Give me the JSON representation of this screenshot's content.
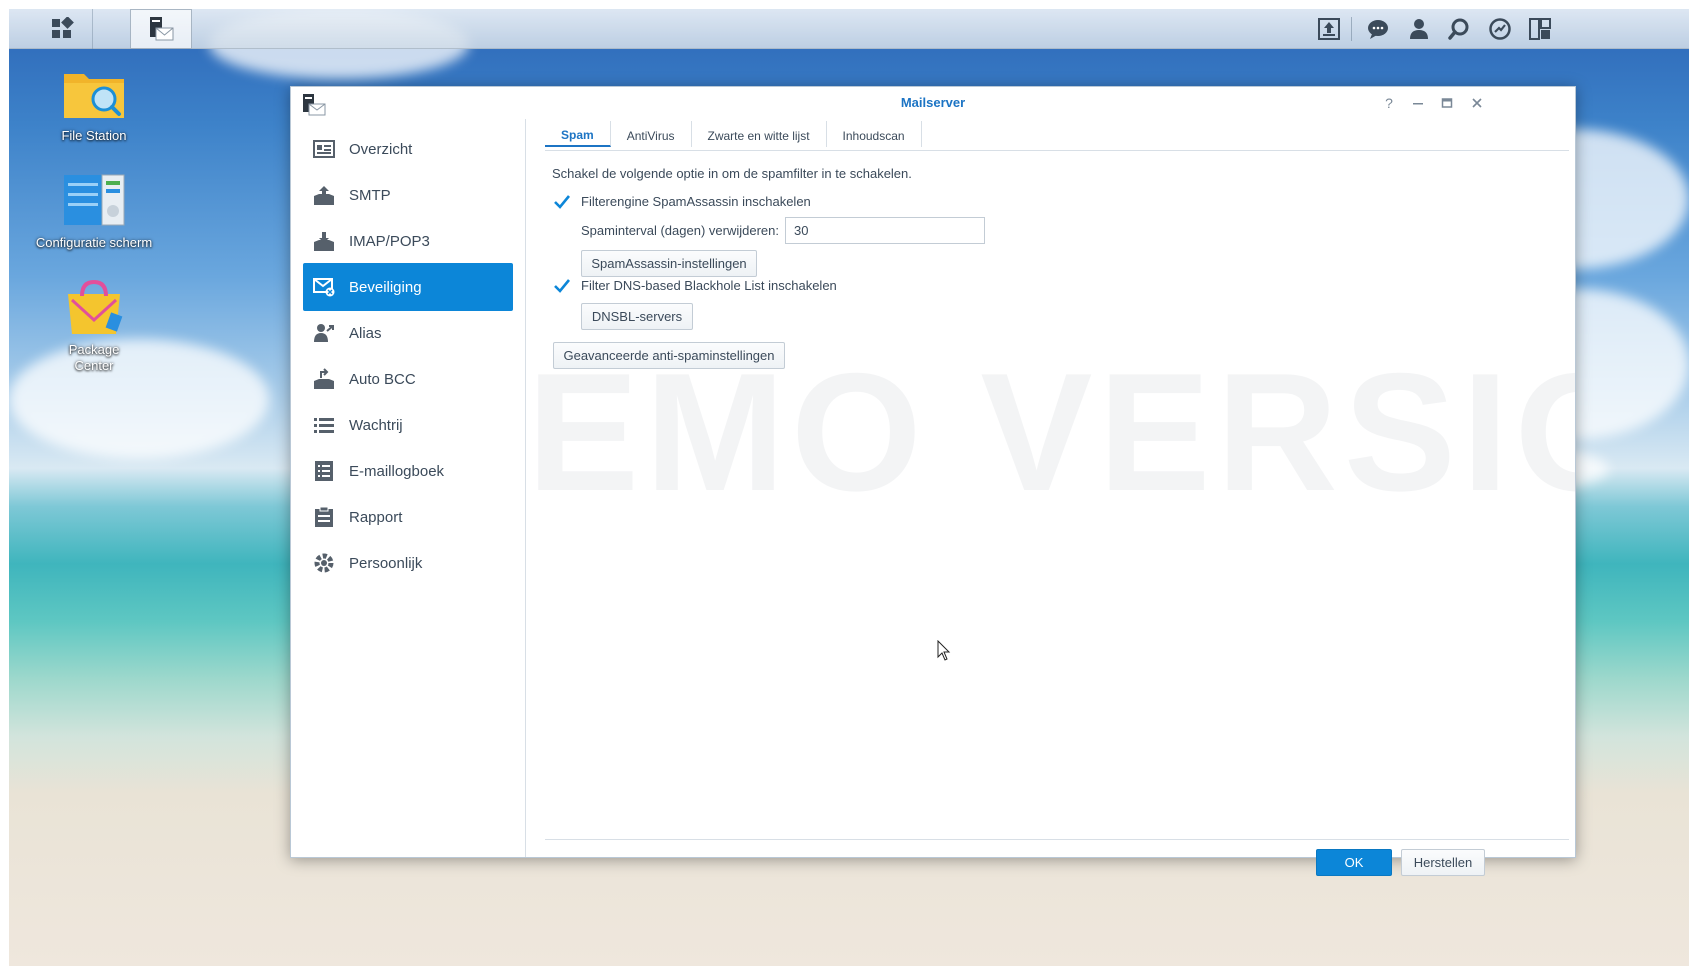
{
  "desktop": {
    "icons": [
      {
        "name": "file-station",
        "label": "File Station"
      },
      {
        "name": "configuratie-scherm",
        "label": "Configuratie scherm"
      },
      {
        "name": "package-center",
        "label": "Package Center"
      }
    ]
  },
  "taskbar": {
    "left_buttons": [
      "main-menu-icon",
      "mailserver-app-icon"
    ],
    "right_icons": [
      "upload-icon",
      "chat-icon",
      "user-icon",
      "search-icon",
      "dashboard-icon",
      "widgets-icon"
    ]
  },
  "window": {
    "title": "Mailserver",
    "controls": [
      "help-icon",
      "minimize-icon",
      "maximize-icon",
      "close-icon"
    ],
    "sidebar": {
      "items": [
        {
          "label": "Overzicht",
          "icon": "overview-icon"
        },
        {
          "label": "SMTP",
          "icon": "smtp-icon"
        },
        {
          "label": "IMAP/POP3",
          "icon": "imap-icon"
        },
        {
          "label": "Beveiliging",
          "icon": "security-icon",
          "selected": true
        },
        {
          "label": "Alias",
          "icon": "alias-icon"
        },
        {
          "label": "Auto BCC",
          "icon": "auto-bcc-icon"
        },
        {
          "label": "Wachtrij",
          "icon": "queue-icon"
        },
        {
          "label": "E-maillogboek",
          "icon": "mail-log-icon"
        },
        {
          "label": "Rapport",
          "icon": "report-icon"
        },
        {
          "label": "Persoonlijk",
          "icon": "personal-icon"
        }
      ]
    },
    "tabs": [
      {
        "label": "Spam",
        "active": true
      },
      {
        "label": "AntiVirus"
      },
      {
        "label": "Zwarte en witte lijst"
      },
      {
        "label": "Inhoudscan"
      }
    ],
    "spam": {
      "intro": "Schakel de volgende optie in om de spamfilter in te schakelen.",
      "spamassassin_label": "Filterengine SpamAssassin inschakelen",
      "spamassassin_checked": true,
      "interval_label": "Spaminterval (dagen) verwijderen:",
      "interval_value": "30",
      "spamassassin_settings_button": "SpamAssassin-instellingen",
      "dnsbl_label": "Filter DNS-based Blackhole List inschakelen",
      "dnsbl_checked": true,
      "dnsbl_servers_button": "DNSBL-servers",
      "advanced_button": "Geavanceerde anti-spaminstellingen"
    },
    "footer": {
      "ok_label": "OK",
      "reset_label": "Herstellen"
    },
    "watermark": "EMO VERSION"
  },
  "colors": {
    "accent": "#0c86d8",
    "title_blue": "#1c74c4",
    "text": "#3b4a5a"
  }
}
